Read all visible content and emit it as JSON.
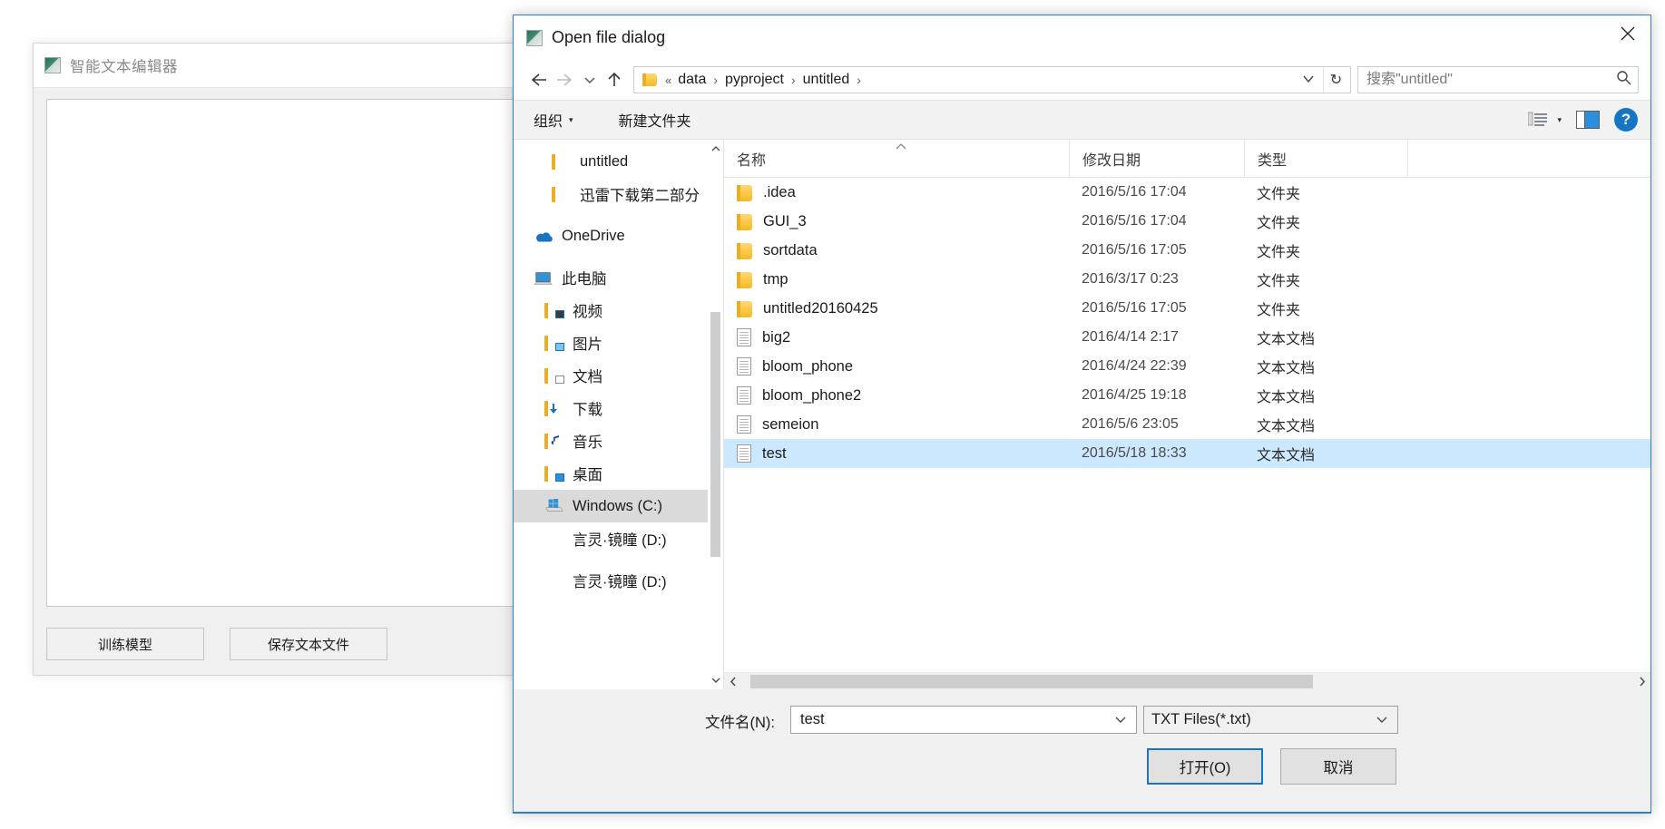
{
  "editor": {
    "title": "智能文本编辑器",
    "icon": "app-icon",
    "buttons": [
      {
        "label": "训练模型",
        "name": "train-model-button"
      },
      {
        "label": "保存文本文件",
        "name": "save-text-file-button"
      }
    ]
  },
  "dialog": {
    "title": "Open file dialog",
    "icon": "app-icon",
    "close_label": "×",
    "nav": {
      "back": "←",
      "forward": "→",
      "recent": "⌄",
      "up": "↑",
      "breadcrumb": {
        "ellipsis": "«",
        "parts": [
          "data",
          "pyproject",
          "untitled"
        ],
        "separator": "›",
        "trailing_separator": "›"
      },
      "dropdown": "⌄",
      "refresh": "↻"
    },
    "search": {
      "placeholder": "搜索\"untitled\"",
      "value": "",
      "icon": "search-icon"
    },
    "toolbar": {
      "organize": "组织",
      "organize_caret": "▾",
      "new_folder": "新建文件夹",
      "view_icon": "list-view-icon",
      "view_caret": "▾",
      "preview_pane_icon": "preview-pane-icon",
      "help_icon": "?",
      "help_label": "?"
    },
    "sidebar": {
      "items": [
        {
          "label": "untitled",
          "icon": "folder-icon",
          "depth": 1,
          "selected": false
        },
        {
          "label": "迅雷下载第二部分",
          "icon": "folder-icon",
          "depth": 1,
          "selected": false
        },
        {
          "label": "OneDrive",
          "icon": "onedrive-icon",
          "depth": 0,
          "selected": false
        },
        {
          "label": "此电脑",
          "icon": "this-pc-icon",
          "depth": 0,
          "selected": false
        },
        {
          "label": "视频",
          "icon": "videos-folder-icon",
          "depth": 2,
          "selected": false
        },
        {
          "label": "图片",
          "icon": "pictures-folder-icon",
          "depth": 2,
          "selected": false
        },
        {
          "label": "文档",
          "icon": "documents-folder-icon",
          "depth": 2,
          "selected": false
        },
        {
          "label": "下载",
          "icon": "downloads-folder-icon",
          "depth": 2,
          "selected": false
        },
        {
          "label": "音乐",
          "icon": "music-folder-icon",
          "depth": 2,
          "selected": false
        },
        {
          "label": "桌面",
          "icon": "desktop-folder-icon",
          "depth": 2,
          "selected": false
        },
        {
          "label": "Windows (C:)",
          "icon": "windows-drive-icon",
          "depth": 2,
          "selected": true
        },
        {
          "label": "言灵·镜瞳 (D:)",
          "icon": "drive-icon",
          "depth": 2,
          "selected": false
        },
        {
          "label": "言灵·镜瞳 (D:)",
          "icon": "drive-icon",
          "depth": 2,
          "selected": false
        }
      ],
      "scroll_up": "⌃",
      "scroll_down": "⌄"
    },
    "columns": [
      {
        "label": "名称",
        "name": "column-name"
      },
      {
        "label": "修改日期",
        "name": "column-date-modified"
      },
      {
        "label": "类型",
        "name": "column-type"
      }
    ],
    "sort_indicator": "⌃",
    "files": [
      {
        "name": ".idea",
        "date": "2016/5/16 17:04",
        "type": "文件夹",
        "icon": "folder-icon",
        "selected": false
      },
      {
        "name": "GUI_3",
        "date": "2016/5/16 17:04",
        "type": "文件夹",
        "icon": "folder-icon",
        "selected": false
      },
      {
        "name": "sortdata",
        "date": "2016/5/16 17:05",
        "type": "文件夹",
        "icon": "folder-icon",
        "selected": false
      },
      {
        "name": "tmp",
        "date": "2016/3/17 0:23",
        "type": "文件夹",
        "icon": "folder-icon",
        "selected": false
      },
      {
        "name": "untitled20160425",
        "date": "2016/5/16 17:05",
        "type": "文件夹",
        "icon": "folder-icon",
        "selected": false
      },
      {
        "name": "big2",
        "date": "2016/4/14 2:17",
        "type": "文本文档",
        "icon": "text-file-icon",
        "selected": false
      },
      {
        "name": "bloom_phone",
        "date": "2016/4/24 22:39",
        "type": "文本文档",
        "icon": "text-file-icon",
        "selected": false
      },
      {
        "name": "bloom_phone2",
        "date": "2016/4/25 19:18",
        "type": "文本文档",
        "icon": "text-file-icon",
        "selected": false
      },
      {
        "name": "semeion",
        "date": "2016/5/6 23:05",
        "type": "文本文档",
        "icon": "text-file-icon",
        "selected": false
      },
      {
        "name": "test",
        "date": "2016/5/18 18:33",
        "type": "文本文档",
        "icon": "text-file-icon",
        "selected": true
      }
    ],
    "hscroll": {
      "left_arrow": "‹",
      "right_arrow": "›"
    },
    "footer": {
      "filename_label": "文件名(N):",
      "filename_value": "test",
      "filename_caret": "⌄",
      "filter_value": "TXT Files(*.txt)",
      "filter_caret": "⌄",
      "open_button": "打开(O)",
      "cancel_button": "取消"
    }
  },
  "colors": {
    "accent": "#1776c4",
    "selection": "#cce8ff",
    "sidebar_selection": "#dadada",
    "folder": "#fcc741",
    "dialog_border": "#2b7fd4"
  }
}
